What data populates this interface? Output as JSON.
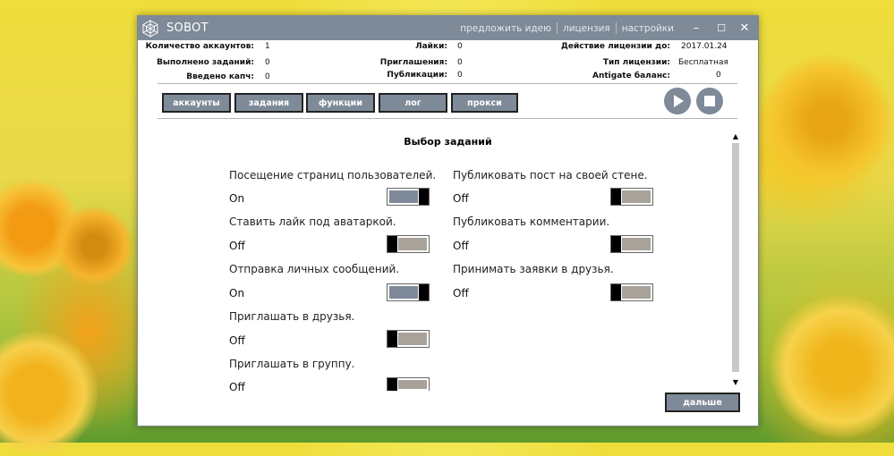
{
  "app": {
    "title": "SOBOT"
  },
  "title_links": [
    "предложить идею",
    "лицензия",
    "настройки"
  ],
  "window_controls": {
    "minimize": "–",
    "maximize": "☐",
    "close": "✕"
  },
  "stats": {
    "accounts_label": "Количество аккаунтов:",
    "accounts_value": "1",
    "tasks_done_label": "Выполнено заданий:",
    "tasks_done_value": "0",
    "captcha_label": "Введено капч:",
    "captcha_value": "0",
    "likes_label": "Лайки:",
    "likes_value": "0",
    "invites_label": "Приглашения:",
    "invites_value": "0",
    "posts_label": "Публикации:",
    "posts_value": "0",
    "license_until_label": "Действие лицензии до:",
    "license_until_value": "2017.01.24",
    "license_type_label": "Тип лицензии:",
    "license_type_value": "Бесплатная",
    "antigate_label": "Antigate баланс:",
    "antigate_value": "0"
  },
  "tabs": [
    "аккаунты",
    "задания",
    "функции",
    "лог",
    "прокси"
  ],
  "section_title": "Выбор заданий",
  "options_left": [
    {
      "label": "Посещение страниц пользователей.",
      "state": "On",
      "on": true
    },
    {
      "label": "Ставить лайк под аватаркой.",
      "state": "Off",
      "on": false
    },
    {
      "label": "Отправка личных сообщений.",
      "state": "On",
      "on": true
    },
    {
      "label": "Приглашать в друзья.",
      "state": "Off",
      "on": false
    },
    {
      "label": "Приглашать в группу.",
      "state": "Off",
      "on": false
    }
  ],
  "options_right": [
    {
      "label": "Публиковать пост на своей стене.",
      "state": "Off",
      "on": false
    },
    {
      "label": "Публиковать комментарии.",
      "state": "Off",
      "on": false
    },
    {
      "label": "Принимать заявки в друзья.",
      "state": "Off",
      "on": false
    }
  ],
  "next_button": "дальше",
  "colors": {
    "accent": "#7e8a98",
    "toggle_off": "#a8a29a",
    "toggle_on": "#7e8a98"
  }
}
